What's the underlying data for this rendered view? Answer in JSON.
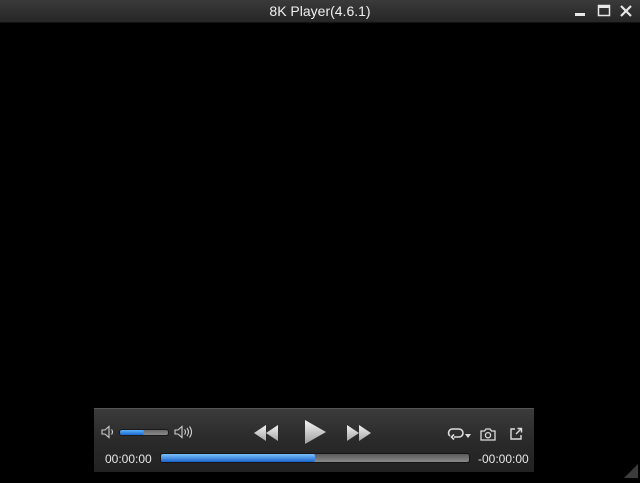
{
  "window": {
    "title": "8K Player(4.6.1)",
    "buttons": {
      "minimize": "minimize-icon",
      "maximize": "maximize-icon",
      "close": "close-icon"
    }
  },
  "controls": {
    "volume_level": 0.5,
    "progress_level": 0.5,
    "elapsed_time": "00:00:00",
    "remaining_time": "-00:00:00",
    "icons": {
      "mute": "speaker-low-icon",
      "volume_max": "speaker-high-icon",
      "rewind": "rewind-icon",
      "play": "play-icon",
      "fast_forward": "fast-forward-icon",
      "loop": "loop-icon",
      "snapshot": "camera-icon",
      "external": "external-link-icon"
    }
  },
  "colors": {
    "accent": "#1a6ad0",
    "background": "#000000",
    "panel": "#2a2a2a"
  }
}
